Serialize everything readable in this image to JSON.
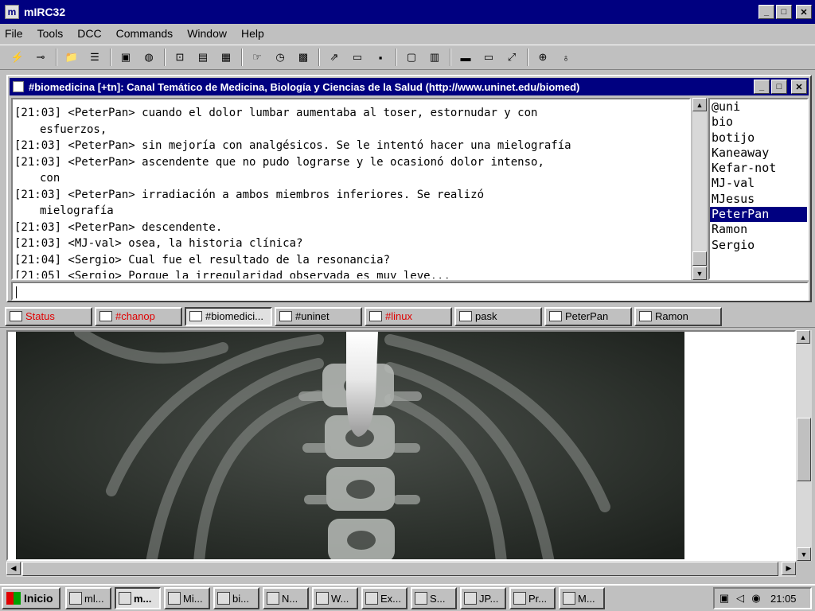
{
  "app": {
    "title": "mIRC32"
  },
  "menu": [
    "File",
    "Tools",
    "DCC",
    "Commands",
    "Window",
    "Help"
  ],
  "toolbar": {
    "icons": [
      "connect-icon",
      "disconnect-icon",
      "options-icon",
      "address-book-icon",
      "channels-list-icon",
      "scripts-editor-icon",
      "aliases-icon",
      "popups-icon",
      "remote-icon",
      "notify-icon",
      "timer-icon",
      "colors-icon",
      "dcc-send-icon",
      "dcc-chat-icon",
      "dcc-options-icon",
      "finger-icon",
      "url-list-icon",
      "cascade-icon",
      "tile-icon",
      "arrange-icon",
      "help-icon",
      "about-icon"
    ]
  },
  "channel": {
    "title": "#biomedicina [+tn]: Canal Temático de Medicina, Biología y Ciencias de la Salud (http://www.uninet.edu/biomed)",
    "messages": [
      {
        "text": "[21:03] <PeterPan>    cuando el dolor lumbar aumentaba al toser, estornudar y con",
        "cont": "esfuerzos,"
      },
      {
        "text": "[21:03] <PeterPan> sin mejoría con analgésicos. Se le intentó hacer una mielografía",
        "cont": ""
      },
      {
        "text": "[21:03] <PeterPan>    ascendente que no pudo lograrse y le ocasionó dolor intenso,",
        "cont": "con"
      },
      {
        "text": "[21:03] <PeterPan>    irradiación a ambos miembros inferiores. Se realizó",
        "cont": "mielografía"
      },
      {
        "text": "[21:03] <PeterPan>    descendente.",
        "cont": ""
      },
      {
        "text": "[21:03] <MJ-val> osea, la historia clínica?",
        "cont": ""
      },
      {
        "text": "[21:04] <Sergio> Cual fue el resultado de la resonancia?",
        "cont": ""
      },
      {
        "text": "[21:05] <Sergio> Porque la irregularidad observada es muy leve...",
        "cont": ""
      }
    ],
    "nicks": [
      "@uni",
      "bio",
      "botijo",
      "Kaneaway",
      "Kefar-not",
      "MJ-val",
      "MJesus",
      "PeterPan",
      "Ramon",
      "Sergio"
    ],
    "selected_nick": "PeterPan",
    "input_value": ""
  },
  "switchbar": [
    {
      "label": "Status",
      "color": "#e00000",
      "active": false
    },
    {
      "label": "#chanop",
      "color": "#e00000",
      "active": false
    },
    {
      "label": "#biomedici...",
      "color": "#000000",
      "active": true
    },
    {
      "label": "#uninet",
      "color": "#000000",
      "active": false
    },
    {
      "label": "#linux",
      "color": "#e00000",
      "active": false
    },
    {
      "label": "pask",
      "color": "#000000",
      "active": false
    },
    {
      "label": "PeterPan",
      "color": "#000000",
      "active": false
    },
    {
      "label": "Ramon",
      "color": "#000000",
      "active": false
    }
  ],
  "taskbar": {
    "start_label": "Inicio",
    "buttons": [
      {
        "label": "ml...",
        "active": false
      },
      {
        "label": "m...",
        "active": true
      },
      {
        "label": "Mi...",
        "active": false
      },
      {
        "label": "bi...",
        "active": false
      },
      {
        "label": "N...",
        "active": false
      },
      {
        "label": "W...",
        "active": false
      },
      {
        "label": "Ex...",
        "active": false
      },
      {
        "label": "S...",
        "active": false
      },
      {
        "label": "JP...",
        "active": false
      },
      {
        "label": "Pr...",
        "active": false
      },
      {
        "label": "M...",
        "active": false
      }
    ],
    "clock": "21:05"
  },
  "colors": {
    "titlebar": "#000080",
    "selection": "#000080",
    "highlight_tab": "#e00000"
  }
}
